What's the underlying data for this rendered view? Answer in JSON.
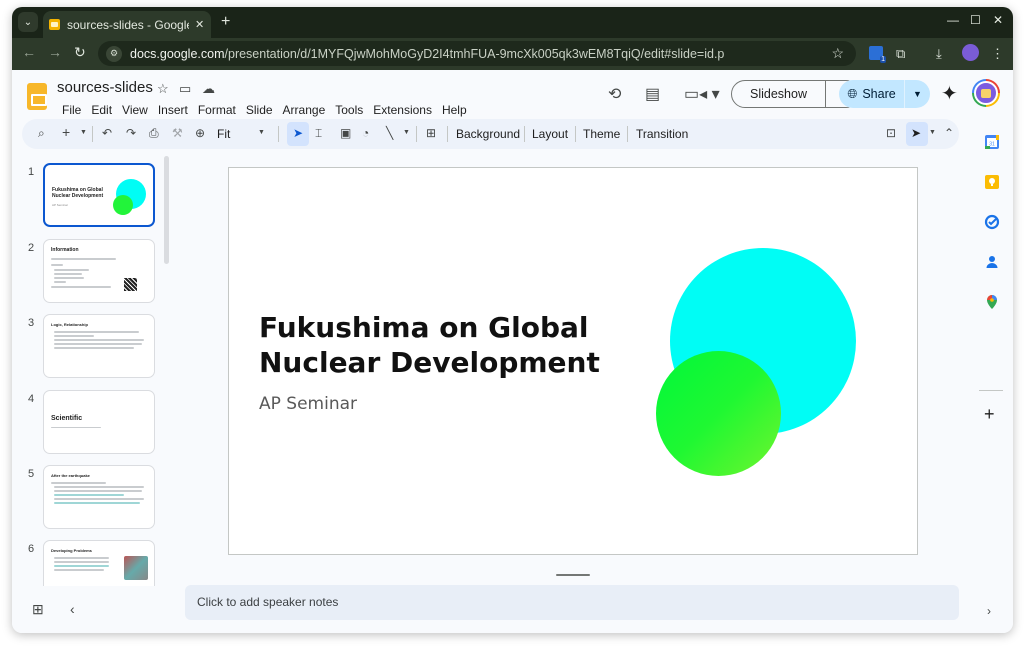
{
  "browser": {
    "tab_title": "sources-slides - Google Slides",
    "tab_title_visible": "sources-slides - Google S",
    "new_tab_label": "+",
    "url_domain": "docs.google.com",
    "url_path": "/presentation/d/1MYFQjwMohMoGyD2I4tmhFUA-9mcXk005qk3wEM8TqiQ/edit#slide=id.p",
    "extension_badge_count": "1",
    "icons": [
      "tab-search-icon",
      "back-icon",
      "forward-icon",
      "reload-icon",
      "site-info-icon",
      "bookmark-star-icon",
      "extensions-icon",
      "download-icon",
      "profile-icon",
      "kebab-menu-icon",
      "minimize-icon",
      "maximize-icon",
      "close-icon"
    ]
  },
  "app": {
    "doc_title": "sources-slides",
    "menu": [
      "File",
      "Edit",
      "View",
      "Insert",
      "Format",
      "Slide",
      "Arrange",
      "Tools",
      "Extensions",
      "Help"
    ],
    "slideshow_label": "Slideshow",
    "share_label": "Share",
    "notes_placeholder": "Click to add speaker notes"
  },
  "toolbar": {
    "zoom_value": "Fit",
    "text_buttons": [
      "Background",
      "Layout",
      "Theme",
      "Transition"
    ]
  },
  "slides": [
    {
      "number": "1",
      "title": "Fukushima on Global Nuclear Development",
      "subtitle": "AP Seminar",
      "active": true
    },
    {
      "number": "2",
      "title": "Information",
      "active": false
    },
    {
      "number": "3",
      "title": "Logic, Relationship",
      "active": false
    },
    {
      "number": "4",
      "title": "Scientific",
      "active": false
    },
    {
      "number": "5",
      "title": "After the earthquake",
      "active": false
    },
    {
      "number": "6",
      "title": "Developing Problems",
      "active": false
    }
  ],
  "current_slide": {
    "title": "Fukushima on Global\nNuclear Development",
    "subtitle": "AP Seminar",
    "colors": {
      "big_circle": "#00fdf5",
      "small_circle_start": "#00f83a",
      "small_circle_end": "#70f52e"
    }
  },
  "side_panel": [
    "calendar-icon",
    "keep-icon",
    "tasks-icon",
    "contacts-icon",
    "maps-icon"
  ]
}
